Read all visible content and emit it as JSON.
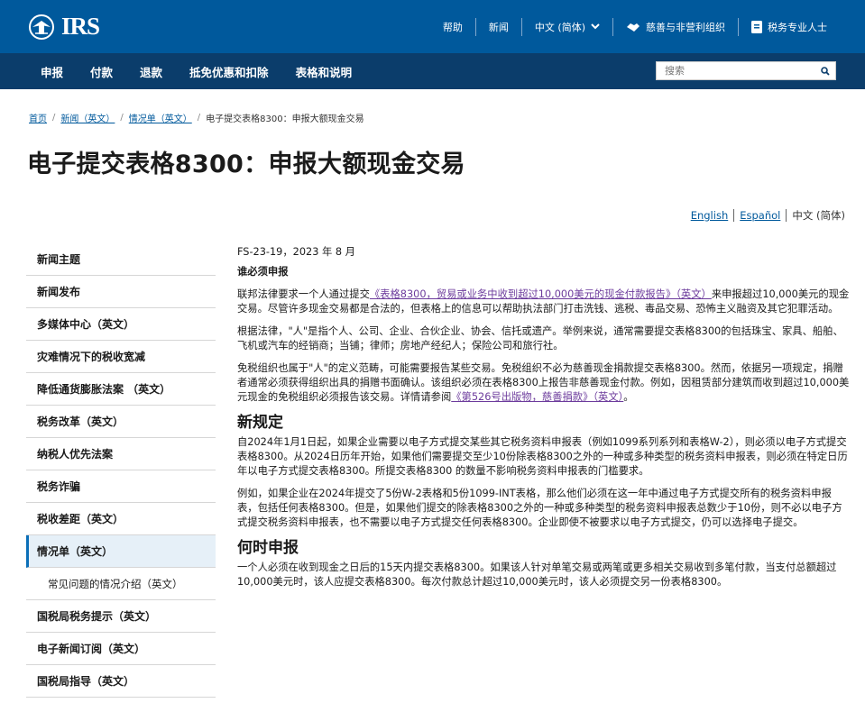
{
  "logo": {
    "text": "IRS"
  },
  "toplinks": {
    "help": "帮助",
    "news": "新闻",
    "language": "中文 (简体)",
    "charities": "慈善与非营利组织",
    "tax_pros": "税务专业人士"
  },
  "nav": {
    "items": [
      "申报",
      "付款",
      "退款",
      "抵免优惠和扣除",
      "表格和说明"
    ],
    "search_placeholder": "搜索"
  },
  "breadcrumb": {
    "home": "首页",
    "news": "新闻（英文）",
    "factsheets": "情况单（英文）",
    "current": "电子提交表格8300：申报大额现金交易"
  },
  "page_title": "电子提交表格8300：申报大额现金交易",
  "languages": {
    "en": "English",
    "es": "Español",
    "zh": "中文 (简体)"
  },
  "sidebar": {
    "items": [
      "新闻主题",
      "新闻发布",
      "多媒体中心（英文）",
      "灾难情况下的税收宽减",
      "降低通货膨胀法案 （英文）",
      "税务改革（英文）",
      "纳税人优先法案",
      "税务诈骗",
      "税收差距（英文）",
      "情况单（英文）",
      "常见问题的情况介绍（英文）",
      "国税局税务提示（英文）",
      "电子新闻订阅（英文）",
      "国税局指导（英文）"
    ]
  },
  "main": {
    "meta": "FS-23-19，2023 年 8 月",
    "section1_title": "谁必须申报",
    "p1_before": "联邦法律要求一个人通过提交",
    "p1_link": "《表格8300，贸易或业务中收到超过10,000美元的现金付款报告》（英文）",
    "p1_after": "来申报超过10,000美元的现金交易。尽管许多现金交易都是合法的，但表格上的信息可以帮助执法部门打击洗钱、逃税、毒品交易、恐怖主义融资及其它犯罪活动。",
    "p2": "根据法律，\"人\"是指个人、公司、企业、合伙企业、协会、信托或遗产。举例来说，通常需要提交表格8300的包括珠宝、家具、船舶、飞机或汽车的经销商；当铺；律师；房地产经纪人；保险公司和旅行社。",
    "p3_before": "免税组织也属于\"人\"的定义范畴，可能需要报告某些交易。免税组织不必为慈善现金捐款提交表格8300。然而，依据另一项规定，捐赠者通常必须获得组织出具的捐赠书面确认。该组织必须在表格8300上报告非慈善现金付款。例如，因租赁部分建筑而收到超过10,000美元现金的免税组织必须报告该交易。详情请参阅",
    "p3_link": "《第526号出版物，慈善捐款》（英文）",
    "p3_after": "。",
    "h2_new": "新规定",
    "p4": "自2024年1月1日起，如果企业需要以电子方式提交某些其它税务资料申报表（例如1099系列系列和表格W-2），则必须以电子方式提交表格8300。从2024日历年开始，如果他们需要提交至少10份除表格8300之外的一种或多种类型的税务资料申报表，则必须在特定日历年以电子方式提交表格8300。所提交表格8300 的数量不影响税务资料申报表的门槛要求。",
    "p5": "例如，如果企业在2024年提交了5份W-2表格和5份1099-INT表格，那么他们必须在这一年中通过电子方式提交所有的税务资料申报表，包括任何表格8300。但是，如果他们提交的除表格8300之外的一种或多种类型的税务资料申报表总数少于10份，则不必以电子方式提交税务资料申报表，也不需要以电子方式提交任何表格8300。企业即使不被要求以电子方式提交，仍可以选择电子提交。",
    "h2_when": "何时申报",
    "p6": "一个人必须在收到现金之日后的15天内提交表格8300。如果该人针对单笔交易或两笔或更多相关交易收到多笔付款，当支付总额超过10,000美元时，该人应提交表格8300。每次付款总计超过10,000美元时，该人必须提交另一份表格8300。"
  }
}
